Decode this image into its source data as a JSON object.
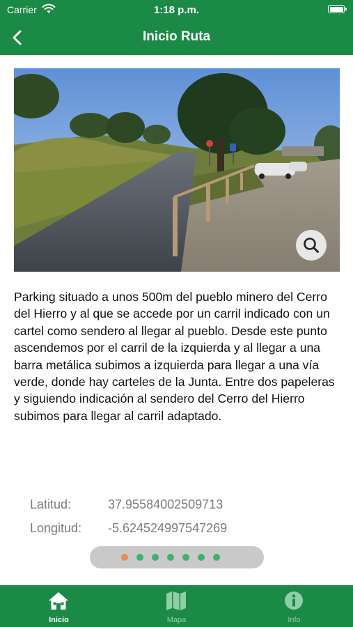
{
  "status_bar": {
    "carrier": "Carrier",
    "time": "1:18 p.m."
  },
  "nav": {
    "title": "Inicio Ruta",
    "back_icon": "chevron-left-icon"
  },
  "photo": {
    "description": "",
    "zoom_icon": "magnifier-icon"
  },
  "description": "Parking situado a unos 500m del pueblo minero del Cerro del Hierro y al que se accede por un carril indicado con un cartel como sendero al llegar al pueblo. Desde este punto ascendemos por el carril de la izquierda y al llegar a una barra metálica subimos a izquierda para llegar a una vía verde, donde hay carteles de la Junta. Entre dos papeleras y siguiendo indicación al sendero del Cerro del Hierro subimos para llegar al carril adaptado.",
  "coordinates": {
    "latitude_label": "Latitud:",
    "latitude_value": "37.95584002509713",
    "longitude_label": "Longitud:",
    "longitude_value": "-5.624524997547269"
  },
  "pager": {
    "total": 7,
    "active_index": 0
  },
  "tabs": [
    {
      "label": "Inicio",
      "icon": "home-icon",
      "active": true
    },
    {
      "label": "Mapa",
      "icon": "map-icon",
      "active": false
    },
    {
      "label": "Info",
      "icon": "info-icon",
      "active": false
    }
  ],
  "colors": {
    "brand_green": "#1a8a46",
    "pager_active": "#f1894a",
    "pager_inactive": "#3bb36a"
  }
}
